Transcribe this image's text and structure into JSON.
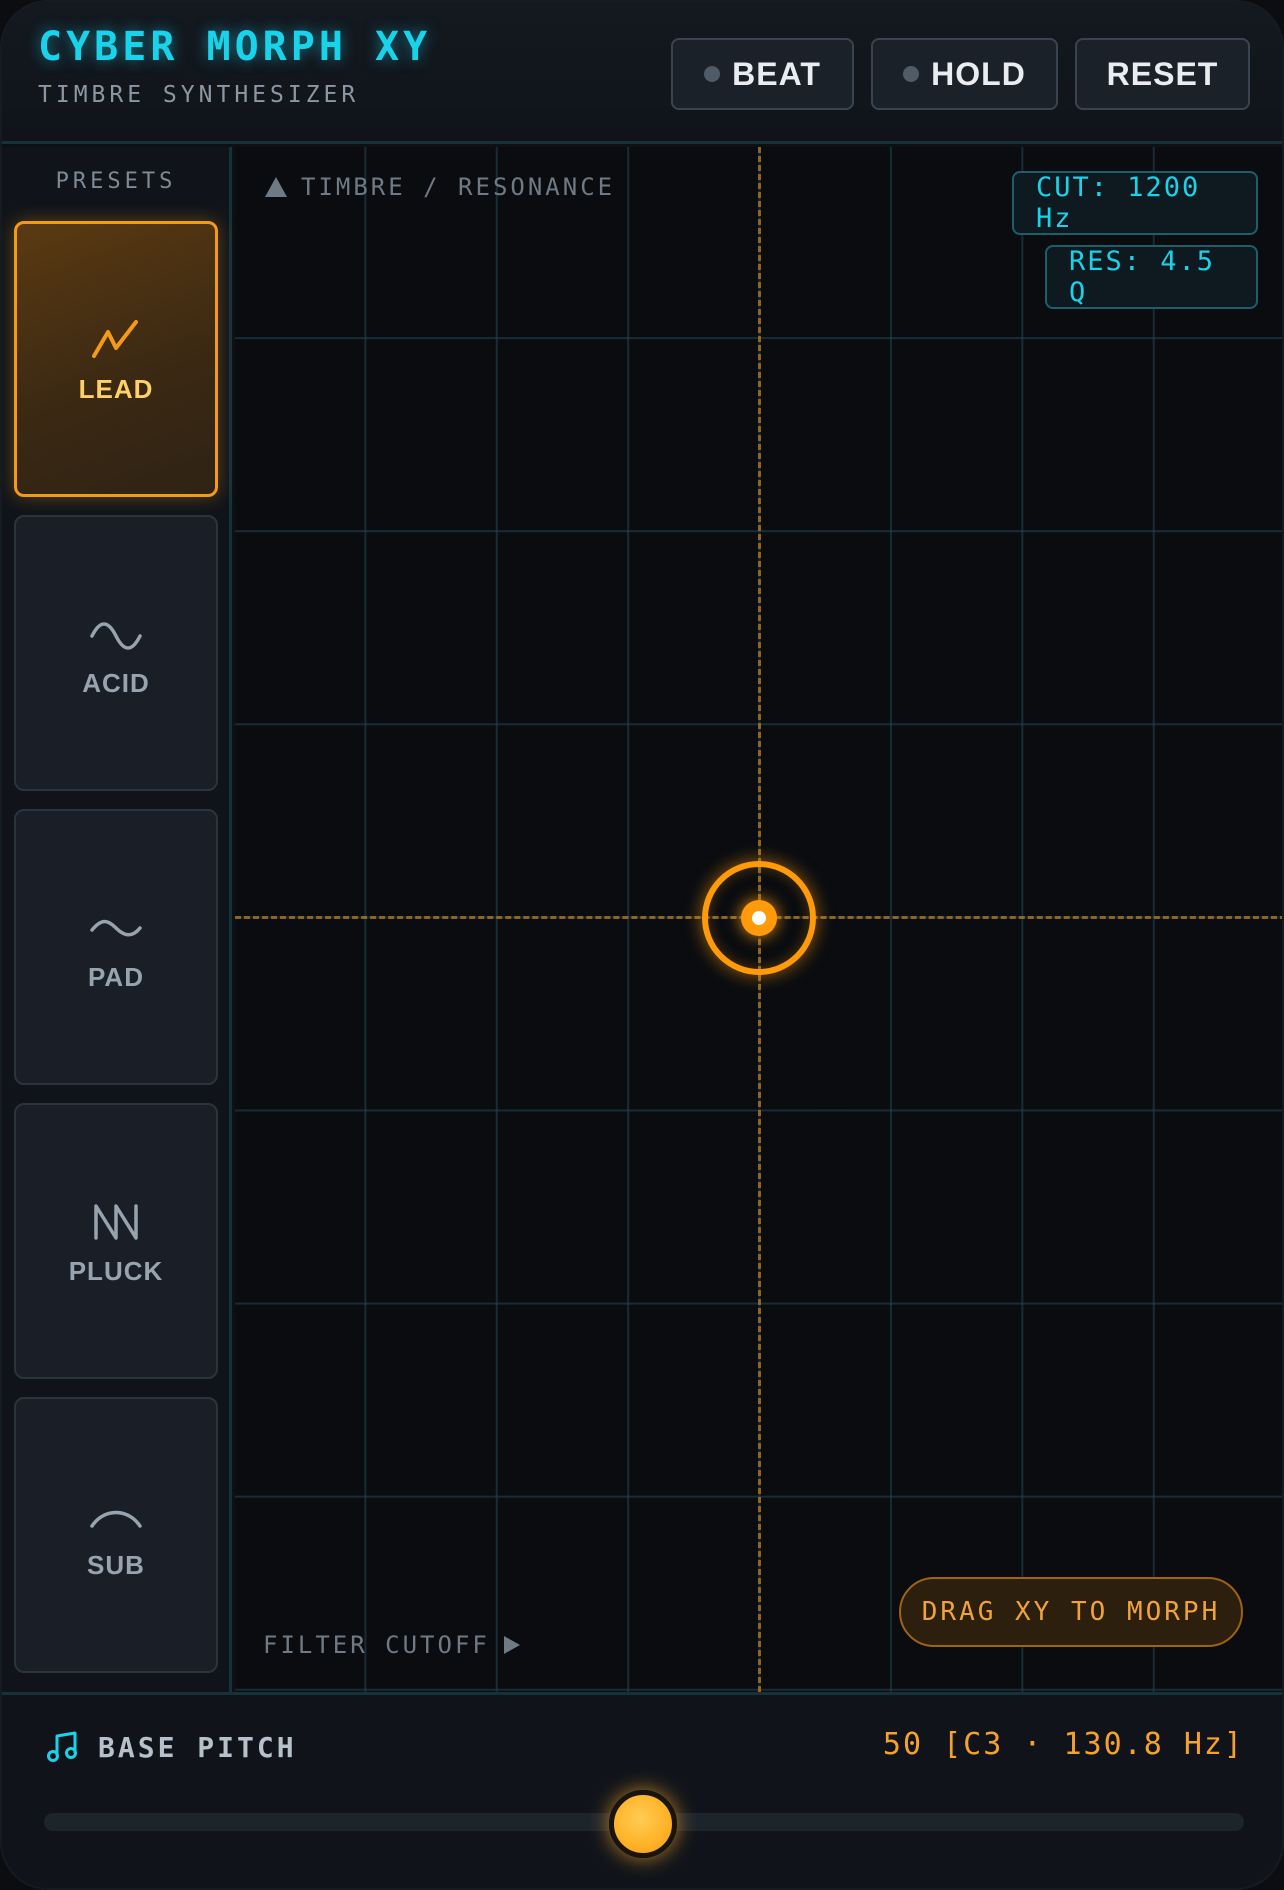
{
  "header": {
    "title": "CYBER MORPH XY",
    "subtitle": "TIMBRE SYNTHESIZER",
    "buttons": [
      {
        "label": "BEAT",
        "has_indicator": true
      },
      {
        "label": "HOLD",
        "has_indicator": true
      },
      {
        "label": "RESET",
        "has_indicator": false
      }
    ]
  },
  "sidebar": {
    "title": "PRESETS",
    "presets": [
      {
        "label": "LEAD",
        "icon": "zigzag-wave-icon",
        "active": true
      },
      {
        "label": "ACID",
        "icon": "sine-wave-icon",
        "active": false
      },
      {
        "label": "PAD",
        "icon": "soft-wave-icon",
        "active": false
      },
      {
        "label": "PLUCK",
        "icon": "sawtooth-wave-icon",
        "active": false
      },
      {
        "label": "SUB",
        "icon": "arc-wave-icon",
        "active": false
      }
    ]
  },
  "xy_pad": {
    "y_axis_label": "TIMBRE / RESONANCE",
    "x_axis_label": "FILTER CUTOFF",
    "cutoff_readout": "CUT: 1200 Hz",
    "resonance_readout": "RES: 4.5 Q",
    "hint": "DRAG XY TO MORPH"
  },
  "footer": {
    "label": "BASE PITCH",
    "value": "50 [C3 · 130.8 Hz]",
    "slider_value": 50,
    "slider_min": 0,
    "slider_max": 100
  },
  "colors": {
    "accent_cyan": "#19d3ea",
    "accent_orange": "#ff9a0a",
    "active_label": "#ffd067",
    "background": "#0d1015"
  }
}
